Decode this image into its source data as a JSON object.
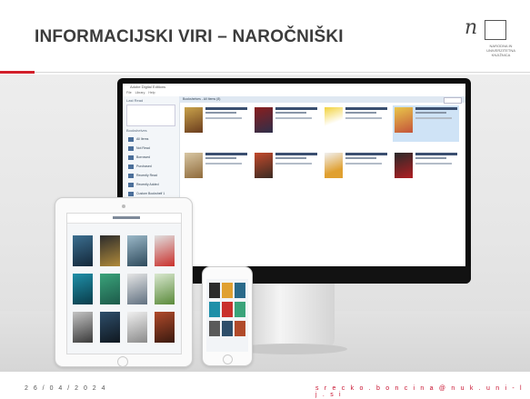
{
  "slide": {
    "title": "INFORMACIJSKI VIRI – NAROČNIŠKI",
    "date": "2 6 / 0 4 / 2 0 2 4",
    "email": "s r e c k o . b o n c i n a @ n u k . u n i - l j . s i"
  },
  "logo": {
    "mark": "nuk",
    "institution": "NARODNA IN UNIVERZITETNA KNJIŽNICA"
  },
  "colors": {
    "accent": "#d21f2a",
    "email": "#c8102e",
    "title": "#3c3c3c"
  },
  "image": {
    "description_icon": "devices-photo",
    "app": "e-book reader library on monitor, tablet and phone"
  }
}
